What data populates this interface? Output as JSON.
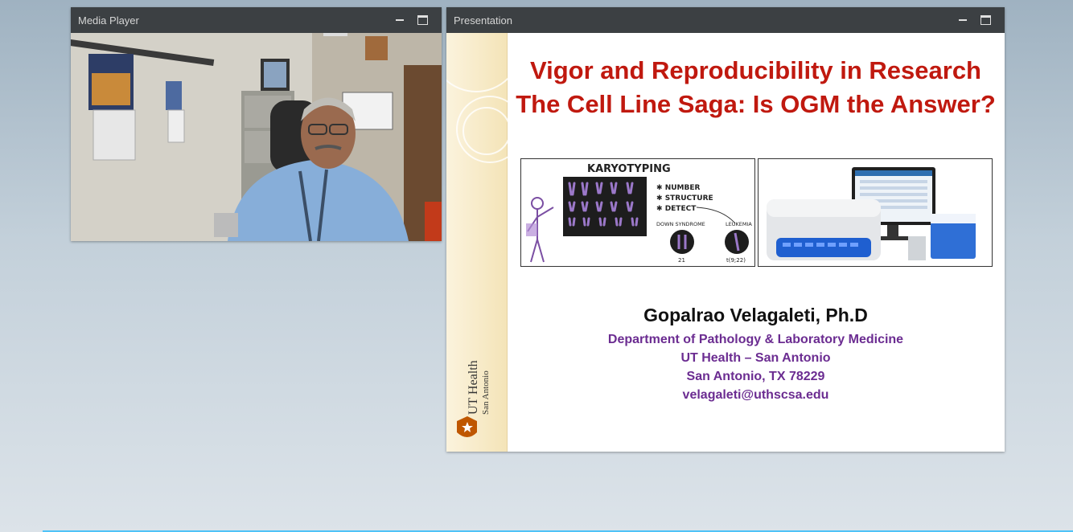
{
  "media_player": {
    "title": "Media Player"
  },
  "presentation": {
    "title": "Presentation",
    "slide": {
      "title_line1": "Vigor and Reproducibility in Research",
      "title_line2": "The Cell Line Saga: Is OGM the Answer?",
      "karyotype_panel": {
        "heading": "KARYOTYPING",
        "bullets": [
          "NUMBER",
          "STRUCTURE",
          "DETECT"
        ],
        "label_left": "DOWN SYNDROME",
        "label_right": "LEUKEMIA",
        "num_left": "21",
        "num_right": "t(9;22)"
      },
      "presenter_name": "Gopalrao Velagaleti, Ph.D",
      "department": "Department of Pathology & Laboratory Medicine",
      "institution": "UT Health – San Antonio",
      "location": "San Antonio, TX 78229",
      "email": "velagaleti@uthscsa.edu",
      "logo_line1": "UT Health",
      "logo_line2": "San Antonio"
    }
  },
  "colors": {
    "title_red": "#c0190f",
    "affiliation_purple": "#6b2c91",
    "titlebar": "#3c4043"
  }
}
